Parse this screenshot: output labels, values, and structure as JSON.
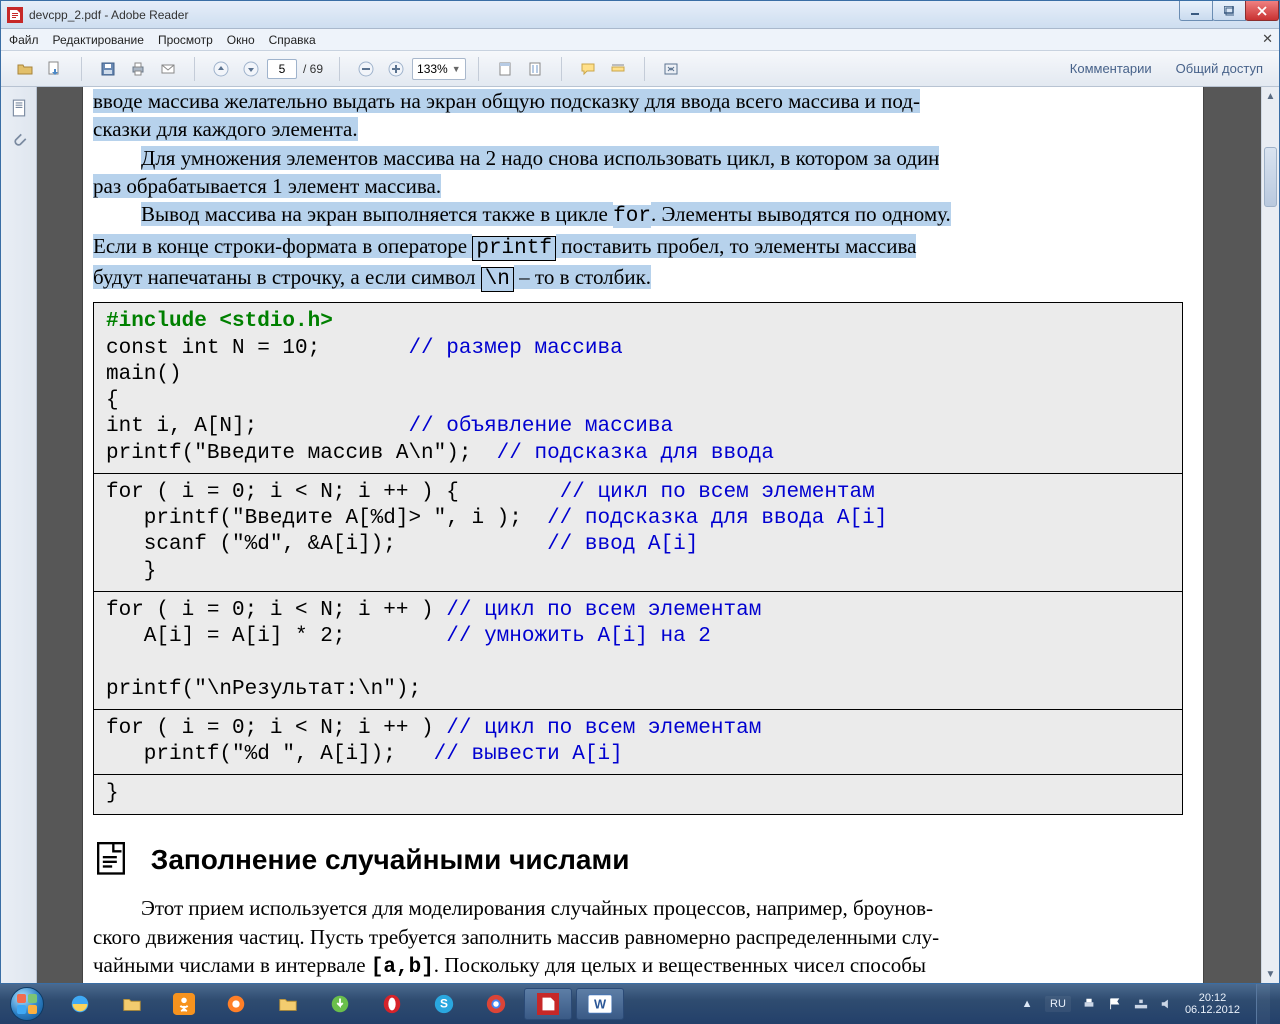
{
  "window": {
    "title": "devcpp_2.pdf - Adobe Reader"
  },
  "menubar": {
    "items": [
      "Файл",
      "Редактирование",
      "Просмотр",
      "Окно",
      "Справка"
    ]
  },
  "toolbar": {
    "page_current": "5",
    "page_total": "/ 69",
    "zoom": "133%",
    "comments_label": "Комментарии",
    "share_label": "Общий доступ"
  },
  "doc": {
    "p1a": "вводе массива желательно выдать на экран общую подсказку для ввода всего массива и под-",
    "p1b": "сказки для каждого элемента.",
    "p2a": "Для умножения элементов массива на 2 надо снова использовать цикл, в котором за один",
    "p2b": "раз обрабатывается 1 элемент массива.",
    "p3a_pre": "Вывод массива на экран выполняется также в цикле ",
    "p3a_for": "for",
    "p3a_post": ". Элементы выводятся по одному.",
    "p3b_pre": "Если в конце строки-формата в операторе ",
    "p3b_printf": "printf",
    "p3b_mid": " поставить пробел, то элементы массива",
    "p3c_pre": "будут напечатаны в строчку, а если символ ",
    "p3c_n": "\\n",
    "p3c_post": " – то в столбик.",
    "code1_l1a": "#include <stdio.h>",
    "code1_l2a": "const int N = 10;       ",
    "code1_l2b": "// размер массива",
    "code1_l3": "main()",
    "code1_l4": "{",
    "code1_l5a": "int i, A[N];            ",
    "code1_l5b": "// объявление массива",
    "code1_l6a": "printf(\"Введите массив A\\n\");  ",
    "code1_l6b": "// подсказка для ввода",
    "code2_l1a": "for ( i = 0; i < N; i ++ ) {        ",
    "code2_l1b": "// цикл по всем элементам",
    "code2_l2a": "   printf(\"Введите A[%d]> \", i );  ",
    "code2_l2b": "// подсказка для ввода A[i]",
    "code2_l3a": "   scanf (\"%d\", &A[i]);            ",
    "code2_l3b": "// ввод A[i]",
    "code2_l4": "   }",
    "code3_l1a": "for ( i = 0; i < N; i ++ ) ",
    "code3_l1b": "// цикл по всем элементам",
    "code3_l2a": "   A[i] = A[i] * 2;        ",
    "code3_l2b": "// умножить A[i] на 2",
    "code3_blank": "",
    "code3_l3": "printf(\"\\nРезультат:\\n\");",
    "code4_l1a": "for ( i = 0; i < N; i ++ ) ",
    "code4_l1b": "// цикл по всем элементам",
    "code4_l2a": "   printf(\"%d \", A[i]);   ",
    "code4_l2b": "// вывести A[i]",
    "code5_l1": "}",
    "h2": "Заполнение случайными числами",
    "p4a": "Этот прием используется для моделирования случайных процессов, например, броунов-",
    "p4b_pre": "ского движения частиц. Пусть требуется заполнить массив равномерно распределенными слу-",
    "p4c_pre": "чайными числами в интервале ",
    "p4c_ab": "[a,b]",
    "p4c_post": ". Поскольку для целых и вещественных чисел способы"
  },
  "tray": {
    "lang": "RU",
    "time": "20:12",
    "date": "06.12.2012"
  }
}
